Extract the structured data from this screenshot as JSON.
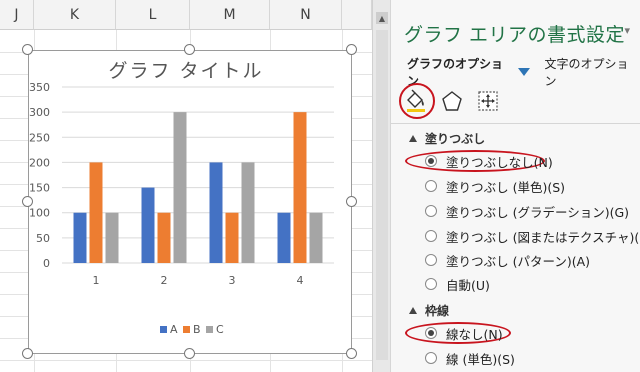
{
  "sheet": {
    "columns": [
      "J",
      "K",
      "L",
      "M",
      "N"
    ]
  },
  "chart": {
    "title": "グラフ タイトル"
  },
  "chart_data": {
    "type": "bar",
    "title": "グラフ タイトル",
    "categories": [
      "1",
      "2",
      "3",
      "4"
    ],
    "series": [
      {
        "name": "A",
        "values": [
          100,
          150,
          200,
          100
        ],
        "color": "#4472c4"
      },
      {
        "name": "B",
        "values": [
          200,
          100,
          100,
          300
        ],
        "color": "#ed7d31"
      },
      {
        "name": "C",
        "values": [
          100,
          300,
          200,
          100
        ],
        "color": "#a5a5a5"
      }
    ],
    "yticks": [
      "0",
      "50",
      "100",
      "150",
      "200",
      "250",
      "300",
      "350"
    ],
    "ylim": [
      0,
      350
    ],
    "grid": true,
    "legend_position": "bottom"
  },
  "pane": {
    "title": "グラフ エリアの書式設定",
    "close_glyph": "▾",
    "tab_graph_options": "グラフのオプション",
    "tab_text_options": "文字のオプション",
    "icons": [
      "fill-line-icon",
      "effects-icon",
      "size-properties-icon"
    ],
    "fill_section": {
      "label": "塗りつぶし",
      "options": [
        {
          "label": "塗りつぶしなし(N)",
          "selected": true
        },
        {
          "label": "塗りつぶし (単色)(S)",
          "selected": false
        },
        {
          "label": "塗りつぶし (グラデーション)(G)",
          "selected": false
        },
        {
          "label": "塗りつぶし (図またはテクスチャ)(P)",
          "selected": false
        },
        {
          "label": "塗りつぶし (パターン)(A)",
          "selected": false
        },
        {
          "label": "自動(U)",
          "selected": false
        }
      ]
    },
    "border_section": {
      "label": "枠線",
      "options": [
        {
          "label": "線なし(N)",
          "selected": true
        },
        {
          "label": "線 (単色)(S)",
          "selected": false
        }
      ]
    }
  },
  "colors": {
    "accent_green": "#217346",
    "highlight_red": "#c8141e",
    "tab_arrow_blue": "#2e75b6"
  }
}
